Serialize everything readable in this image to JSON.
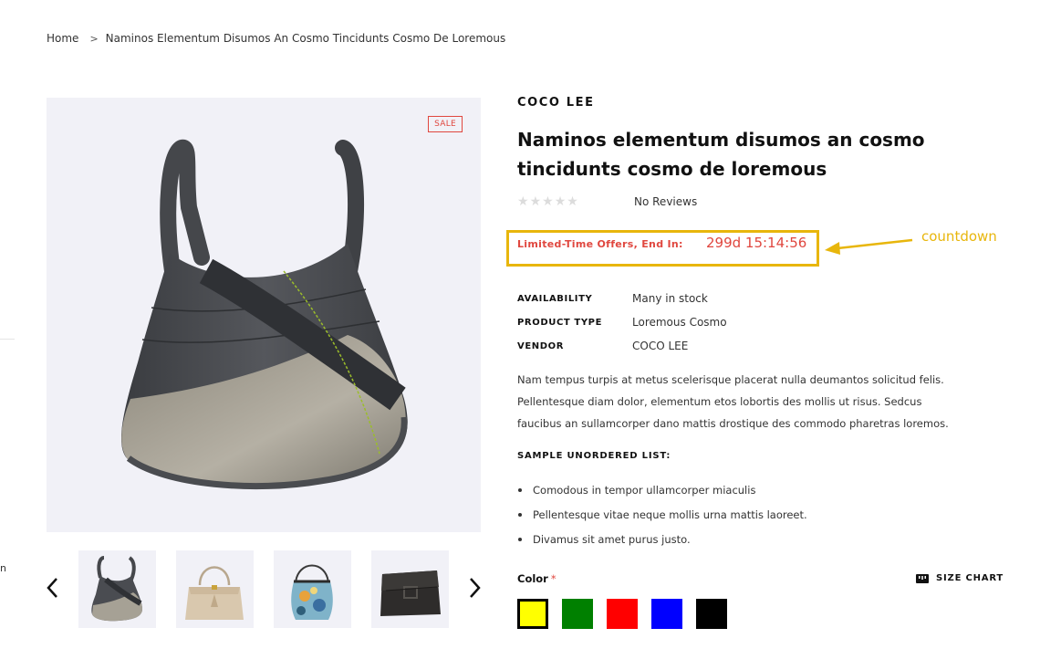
{
  "breadcrumb": {
    "home": "Home",
    "separator": ">",
    "current": "Naminos Elementum Disumos An Cosmo Tincidunts Cosmo De Loremous"
  },
  "stray_text": "n",
  "gallery": {
    "sale_badge": "SALE",
    "prev_icon": "chevron-left-icon",
    "next_icon": "chevron-right-icon",
    "thumbnails": [
      "grey-hobo-bag",
      "beige-handbag",
      "floral-shoulder-bag",
      "black-leather-bag"
    ]
  },
  "product": {
    "vendor_heading": "COCO LEE",
    "title": "Naminos elementum disumos an cosmo tincidunts cosmo de loremous",
    "rating_stars": 0,
    "reviews": "No Reviews",
    "countdown_label": "Limited-Time Offers, End In:",
    "countdown_value": "299d 15:14:56",
    "annotation": "countdown",
    "meta": [
      {
        "key": "AVAILABILITY",
        "value": "Many in stock"
      },
      {
        "key": "PRODUCT TYPE",
        "value": "Loremous Cosmo"
      },
      {
        "key": "VENDOR",
        "value": "COCO LEE"
      }
    ],
    "description_lines": [
      "Nam tempus turpis at metus scelerisque placerat nulla deumantos solicitud felis.",
      "Pellentesque diam dolor, elementum etos lobortis des mollis ut risus. Sedcus",
      "faucibus an sullamcorper dano mattis drostique des commodo pharetras loremos."
    ],
    "list_title": "SAMPLE UNORDERED LIST:",
    "list_items": [
      "Comodous in tempor ullamcorper miaculis",
      "Pellentesque vitae neque mollis urna mattis laoreet.",
      "Divamus sit amet purus justo."
    ],
    "color_label": "Color",
    "required_mark": "*",
    "size_chart": "SIZE CHART",
    "size_chart_icon": "ruler-icon",
    "colors": [
      {
        "name": "yellow",
        "hex": "#ffff00",
        "selected": true
      },
      {
        "name": "green",
        "hex": "#008000",
        "selected": false
      },
      {
        "name": "red",
        "hex": "#ff0000",
        "selected": false
      },
      {
        "name": "blue",
        "hex": "#0000ff",
        "selected": false
      },
      {
        "name": "black",
        "hex": "#000000",
        "selected": false
      }
    ]
  },
  "theme": {
    "accent_red": "#e0473f",
    "annotation_yellow": "#e8b60c",
    "image_bg": "#f1f1f7"
  }
}
